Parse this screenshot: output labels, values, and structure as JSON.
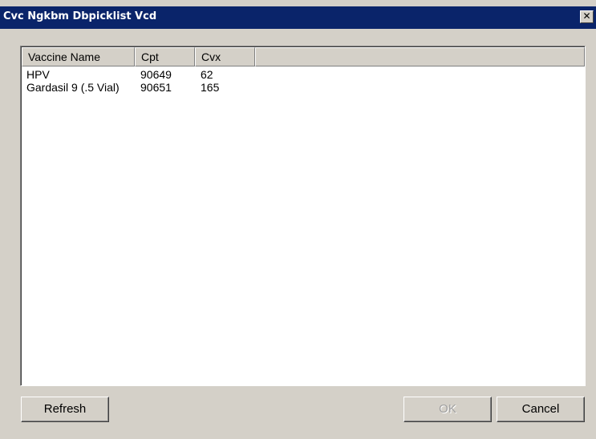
{
  "window": {
    "title": "Cvc Ngkbm Dbpicklist Vcd",
    "close_label": "✕"
  },
  "list": {
    "columns": [
      "Vaccine Name",
      "Cpt",
      "Cvx"
    ],
    "rows": [
      [
        "HPV",
        "90649",
        "62"
      ],
      [
        "Gardasil 9 (.5 Vial)",
        "90651",
        "165"
      ]
    ]
  },
  "buttons": {
    "refresh": "Refresh",
    "ok": "OK",
    "cancel": "Cancel"
  }
}
